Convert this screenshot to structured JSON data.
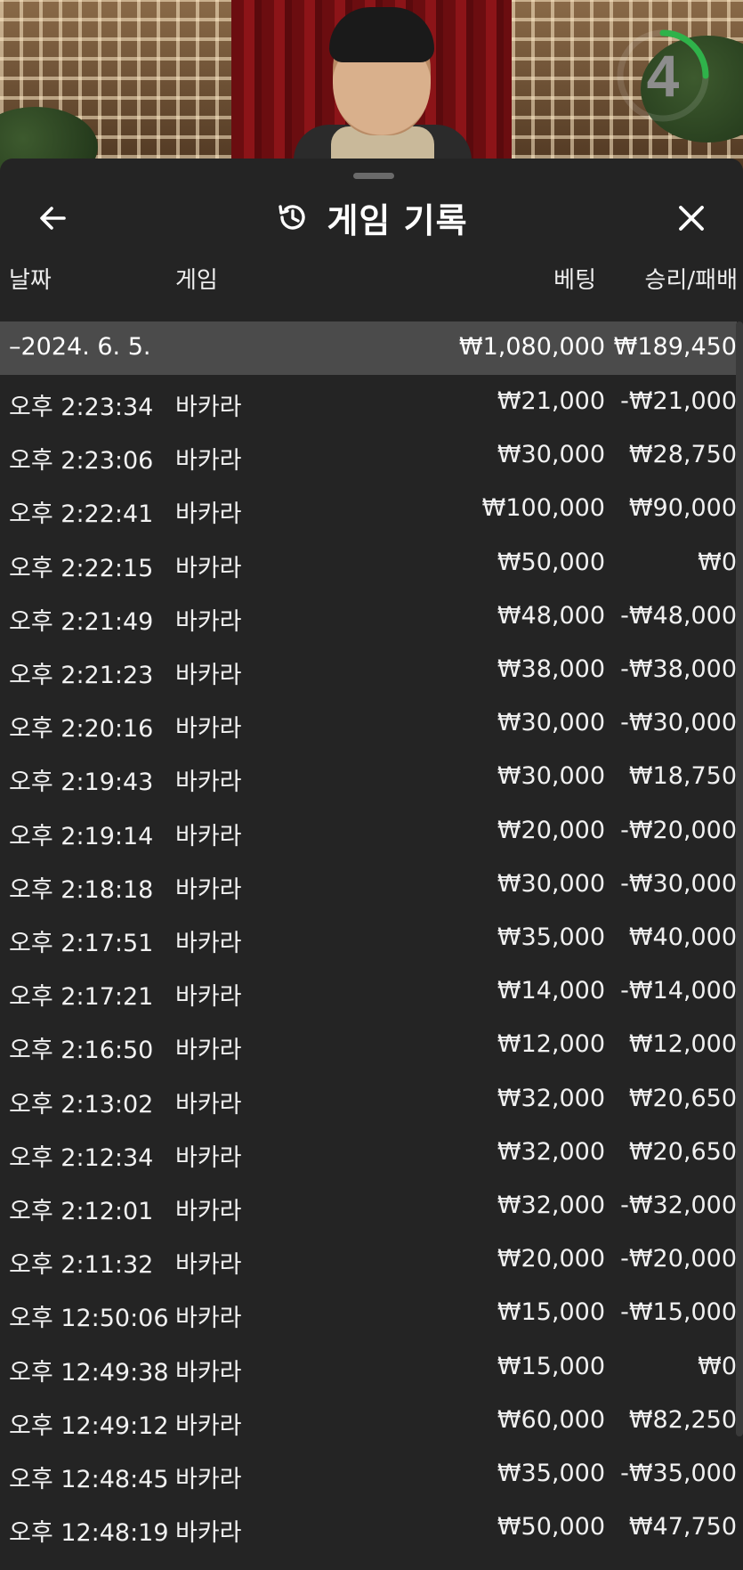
{
  "stream": {
    "timer_value": "4",
    "timer_color": "#2fb24a"
  },
  "sheet": {
    "title": "게임 기록",
    "icons": {
      "back": "arrow-left-icon",
      "history": "history-icon",
      "close": "close-icon"
    },
    "columns": {
      "date": "날짜",
      "game": "게임",
      "bet": "베팅",
      "result": "승리/패배"
    },
    "date_group": {
      "label": "–2024. 6. 5.",
      "total_bet": "₩1,080,000",
      "total_result": "₩189,450"
    },
    "rows": [
      {
        "time": "오후 2:23:34",
        "game": "바카라",
        "bet": "₩21,000",
        "result": "-₩21,000"
      },
      {
        "time": "오후 2:23:06",
        "game": "바카라",
        "bet": "₩30,000",
        "result": "₩28,750"
      },
      {
        "time": "오후 2:22:41",
        "game": "바카라",
        "bet": "₩100,000",
        "result": "₩90,000"
      },
      {
        "time": "오후 2:22:15",
        "game": "바카라",
        "bet": "₩50,000",
        "result": "₩0"
      },
      {
        "time": "오후 2:21:49",
        "game": "바카라",
        "bet": "₩48,000",
        "result": "-₩48,000"
      },
      {
        "time": "오후 2:21:23",
        "game": "바카라",
        "bet": "₩38,000",
        "result": "-₩38,000"
      },
      {
        "time": "오후 2:20:16",
        "game": "바카라",
        "bet": "₩30,000",
        "result": "-₩30,000"
      },
      {
        "time": "오후 2:19:43",
        "game": "바카라",
        "bet": "₩30,000",
        "result": "₩18,750"
      },
      {
        "time": "오후 2:19:14",
        "game": "바카라",
        "bet": "₩20,000",
        "result": "-₩20,000"
      },
      {
        "time": "오후 2:18:18",
        "game": "바카라",
        "bet": "₩30,000",
        "result": "-₩30,000"
      },
      {
        "time": "오후 2:17:51",
        "game": "바카라",
        "bet": "₩35,000",
        "result": "₩40,000"
      },
      {
        "time": "오후 2:17:21",
        "game": "바카라",
        "bet": "₩14,000",
        "result": "-₩14,000"
      },
      {
        "time": "오후 2:16:50",
        "game": "바카라",
        "bet": "₩12,000",
        "result": "₩12,000"
      },
      {
        "time": "오후 2:13:02",
        "game": "바카라",
        "bet": "₩32,000",
        "result": "₩20,650"
      },
      {
        "time": "오후 2:12:34",
        "game": "바카라",
        "bet": "₩32,000",
        "result": "₩20,650"
      },
      {
        "time": "오후 2:12:01",
        "game": "바카라",
        "bet": "₩32,000",
        "result": "-₩32,000"
      },
      {
        "time": "오후 2:11:32",
        "game": "바카라",
        "bet": "₩20,000",
        "result": "-₩20,000"
      },
      {
        "time": "오후 12:50:06",
        "game": "바카라",
        "bet": "₩15,000",
        "result": "-₩15,000"
      },
      {
        "time": "오후 12:49:38",
        "game": "바카라",
        "bet": "₩15,000",
        "result": "₩0"
      },
      {
        "time": "오후 12:49:12",
        "game": "바카라",
        "bet": "₩60,000",
        "result": "₩82,250"
      },
      {
        "time": "오후 12:48:45",
        "game": "바카라",
        "bet": "₩35,000",
        "result": "-₩35,000"
      },
      {
        "time": "오후 12:48:19",
        "game": "바카라",
        "bet": "₩50,000",
        "result": "₩47,750"
      }
    ]
  }
}
